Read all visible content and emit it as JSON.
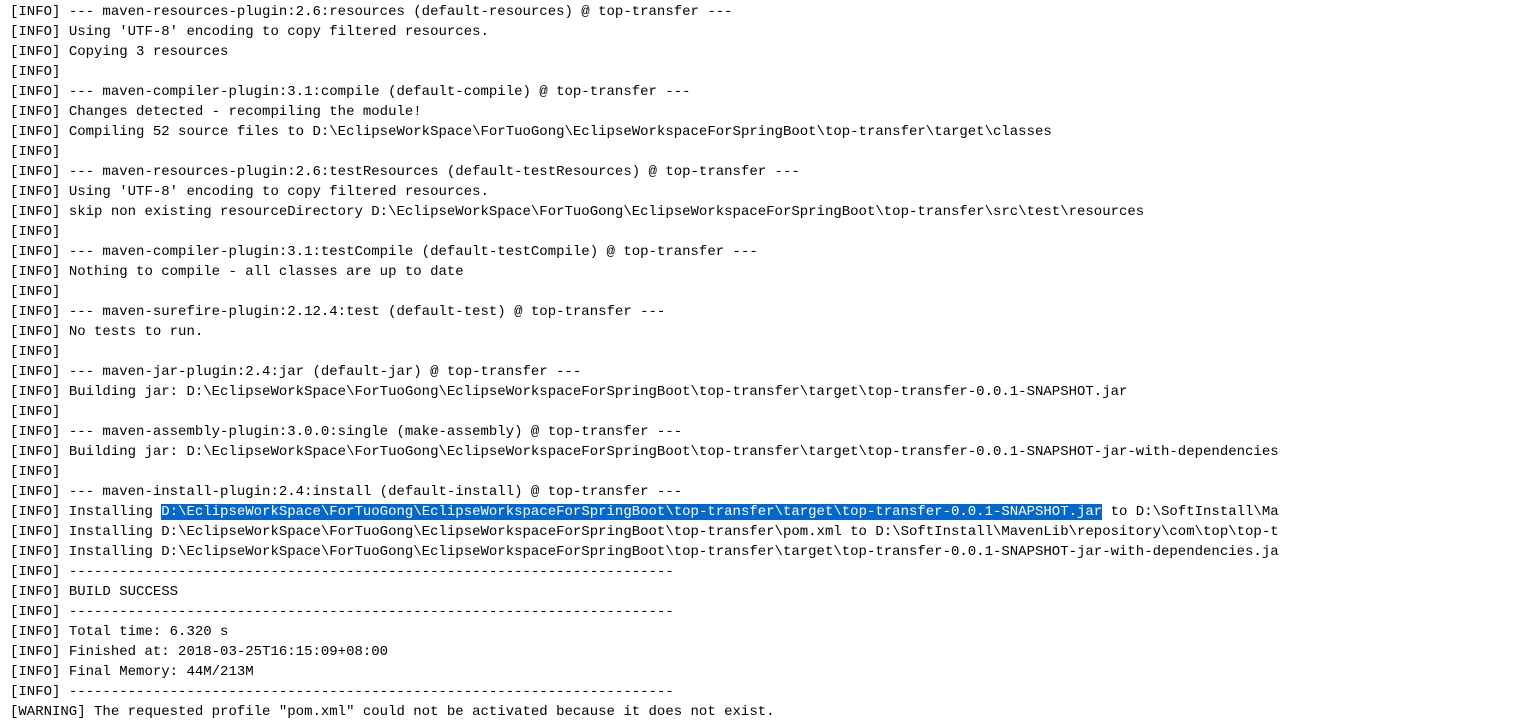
{
  "label_info": "[INFO]",
  "label_warning": "[WARNING]",
  "lines": {
    "l1": "--- maven-resources-plugin:2.6:resources (default-resources) @ top-transfer ---",
    "l2": "Using 'UTF-8' encoding to copy filtered resources.",
    "l3": "Copying 3 resources",
    "l4": "",
    "l5": "--- maven-compiler-plugin:3.1:compile (default-compile) @ top-transfer ---",
    "l6": "Changes detected - recompiling the module!",
    "l7": "Compiling 52 source files to D:\\EclipseWorkSpace\\ForTuoGong\\EclipseWorkspaceForSpringBoot\\top-transfer\\target\\classes",
    "l8": "",
    "l9": "--- maven-resources-plugin:2.6:testResources (default-testResources) @ top-transfer ---",
    "l10": "Using 'UTF-8' encoding to copy filtered resources.",
    "l11": "skip non existing resourceDirectory D:\\EclipseWorkSpace\\ForTuoGong\\EclipseWorkspaceForSpringBoot\\top-transfer\\src\\test\\resources",
    "l12": "",
    "l13": "--- maven-compiler-plugin:3.1:testCompile (default-testCompile) @ top-transfer ---",
    "l14": "Nothing to compile - all classes are up to date",
    "l15": "",
    "l16": "--- maven-surefire-plugin:2.12.4:test (default-test) @ top-transfer ---",
    "l17": "No tests to run.",
    "l18": "",
    "l19": "--- maven-jar-plugin:2.4:jar (default-jar) @ top-transfer ---",
    "l20": "Building jar: D:\\EclipseWorkSpace\\ForTuoGong\\EclipseWorkspaceForSpringBoot\\top-transfer\\target\\top-transfer-0.0.1-SNAPSHOT.jar",
    "l21": "",
    "l22": "--- maven-assembly-plugin:3.0.0:single (make-assembly) @ top-transfer ---",
    "l23": "Building jar: D:\\EclipseWorkSpace\\ForTuoGong\\EclipseWorkspaceForSpringBoot\\top-transfer\\target\\top-transfer-0.0.1-SNAPSHOT-jar-with-dependencies",
    "l24": "",
    "l25": "--- maven-install-plugin:2.4:install (default-install) @ top-transfer ---",
    "l26a": "Installing ",
    "l26sel": "D:\\EclipseWorkSpace\\ForTuoGong\\EclipseWorkspaceForSpringBoot\\top-transfer\\target\\top-transfer-0.0.1-SNAPSHOT.jar",
    "l26b": " to D:\\SoftInstall\\Ma",
    "l27": "Installing D:\\EclipseWorkSpace\\ForTuoGong\\EclipseWorkspaceForSpringBoot\\top-transfer\\pom.xml to D:\\SoftInstall\\MavenLib\\repository\\com\\top\\top-t",
    "l28": "Installing D:\\EclipseWorkSpace\\ForTuoGong\\EclipseWorkspaceForSpringBoot\\top-transfer\\target\\top-transfer-0.0.1-SNAPSHOT-jar-with-dependencies.ja",
    "l29": "------------------------------------------------------------------------",
    "l30": "BUILD SUCCESS",
    "l31": "------------------------------------------------------------------------",
    "l32": "Total time: 6.320 s",
    "l33": "Finished at: 2018-03-25T16:15:09+08:00",
    "l34": "Final Memory: 44M/213M",
    "l35": "------------------------------------------------------------------------",
    "l36": "The requested profile \"pom.xml\" could not be activated because it does not exist."
  }
}
